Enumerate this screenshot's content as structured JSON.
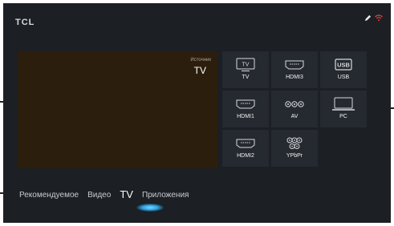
{
  "brand": "TCL",
  "status_icons": [
    "pencil-icon",
    "wifi-icon"
  ],
  "preview": {
    "source_label": "Источник",
    "source_value": "TV"
  },
  "sources": [
    {
      "label": "TV",
      "icon": "tv-icon"
    },
    {
      "label": "HDMI3",
      "icon": "hdmi-icon"
    },
    {
      "label": "USB",
      "icon": "usb-icon"
    },
    {
      "label": "HDMI1",
      "icon": "hdmi-icon"
    },
    {
      "label": "AV",
      "icon": "av-icon"
    },
    {
      "label": "PC",
      "icon": "pc-icon"
    },
    {
      "label": "HDMI2",
      "icon": "hdmi-icon"
    },
    {
      "label": "YPbPr",
      "icon": "ypbpr-icon"
    }
  ],
  "icon_text": {
    "tv": "TV",
    "usb": "USB"
  },
  "tabs": [
    {
      "label": "Рекомендуемое"
    },
    {
      "label": "Видео"
    },
    {
      "label": "TV",
      "active": true
    },
    {
      "label": "Приложения"
    }
  ],
  "colors": {
    "screen_bg": "#1c1f24",
    "preview_bg": "#2c1e0c",
    "tile_bg": "#252a30",
    "accent_glow": "#2aa3e6",
    "wifi": "#e0403a"
  }
}
